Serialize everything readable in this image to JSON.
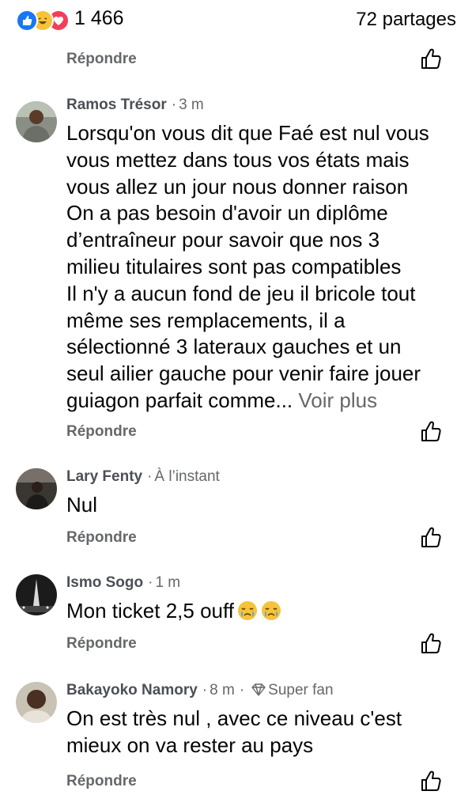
{
  "header": {
    "reaction_count": "1 466",
    "shares": "72 partages"
  },
  "reply_label": "Répondre",
  "comments": [
    {
      "author": "Ramos Trésor",
      "time": "3 m",
      "lines": [
        "Lorsqu'on vous dit que Faé est nul vous",
        "vous mettez dans tous vos états mais",
        "vous allez un jour nous donner raison",
        "On a pas besoin d'avoir un diplôme",
        "d’entraîneur pour savoir que nos 3",
        "milieu  titulaires sont pas compatibles",
        "Il n'y a aucun fond de jeu il bricole tout",
        "même ses remplacements, il a",
        "sélectionné 3 lateraux gauches et un",
        "seul ailier gauche pour venir faire jouer",
        "guiagon parfait comme..."
      ],
      "see_more": "Voir plus"
    },
    {
      "author": "Lary Fenty",
      "time": "À l’instant",
      "lines": [
        "Nul"
      ]
    },
    {
      "author": "Ismo Sogo",
      "time": "1 m",
      "lines": [
        "Mon ticket 2,5 ouff"
      ],
      "emoji": "crying-face"
    },
    {
      "author": "Bakayoko Namory",
      "time": "8 m",
      "badge": "Super fan",
      "lines": [
        "On est très nul , avec ce niveau c'est",
        "mieux on va rester au pays"
      ]
    }
  ]
}
